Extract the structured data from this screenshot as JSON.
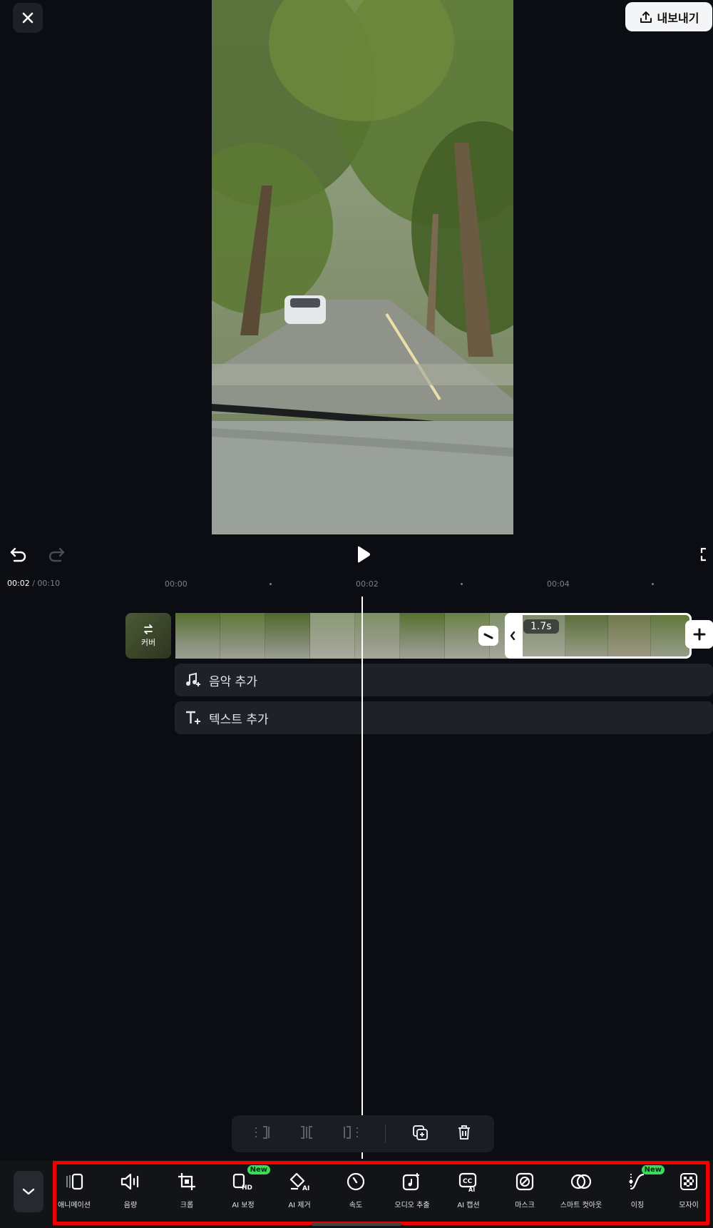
{
  "header": {
    "export_label": "내보내기"
  },
  "timeline": {
    "current_time": "00:02",
    "total_time": " / 00:10",
    "ticks": [
      "00:00",
      "00:02",
      "00:04"
    ],
    "cover_label": "커버",
    "selected_duration": "1.7s",
    "music_track_label": "음악 추가",
    "text_track_label": "텍스트 추가"
  },
  "toolbar": {
    "tools": [
      {
        "label": "애니메이션",
        "icon": "animation-icon"
      },
      {
        "label": "음량",
        "icon": "volume-icon"
      },
      {
        "label": "크롭",
        "icon": "crop-icon"
      },
      {
        "label": "AI 보정",
        "icon": "ai-enhance-icon",
        "badge": "New"
      },
      {
        "label": "AI 제거",
        "icon": "ai-remove-icon"
      },
      {
        "label": "속도",
        "icon": "speed-icon"
      },
      {
        "label": "오디오 추출",
        "icon": "audio-extract-icon"
      },
      {
        "label": "AI 캡션",
        "icon": "ai-caption-icon"
      },
      {
        "label": "마스크",
        "icon": "mask-icon"
      },
      {
        "label": "스마트 컷아웃",
        "icon": "smart-cutout-icon"
      },
      {
        "label": "이징",
        "icon": "easing-icon",
        "badge": "New"
      },
      {
        "label": "모자이",
        "icon": "mosaic-icon"
      }
    ]
  },
  "colors": {
    "background": "#0b0d12",
    "highlight": "#f00000",
    "new_badge": "#3cdc5a"
  }
}
